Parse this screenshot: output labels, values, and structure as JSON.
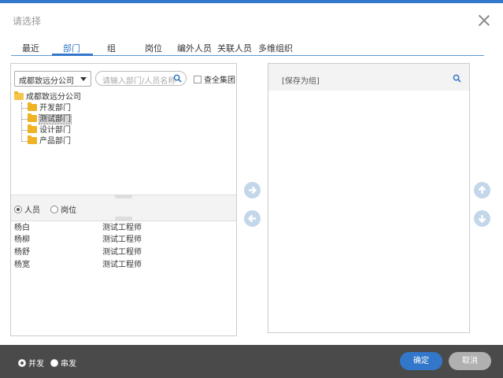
{
  "dialog": {
    "title": "请选择"
  },
  "tabs": [
    {
      "label": "最近"
    },
    {
      "label": "部门"
    },
    {
      "label": "组"
    },
    {
      "label": "岗位"
    },
    {
      "label": "编外人员"
    },
    {
      "label": "关联人员"
    },
    {
      "label": "多维组织"
    }
  ],
  "active_tab": "部门",
  "left": {
    "company_select": "成都致远分公司",
    "search_placeholder": "请输入部门/人员名称",
    "check_all_group": "查全集团",
    "tree": {
      "root": "成都致远分公司",
      "children": [
        "开发部门",
        "测试部门",
        "设计部门",
        "产品部门"
      ],
      "selected": "测试部门"
    },
    "radio_person": "人员",
    "radio_post": "岗位",
    "people": [
      {
        "name": "杨白",
        "role": "测试工程师"
      },
      {
        "name": "杨柳",
        "role": "测试工程师"
      },
      {
        "name": "杨舒",
        "role": "测试工程师"
      },
      {
        "name": "杨宽",
        "role": "测试工程师"
      }
    ]
  },
  "right": {
    "title": "[保存为组]"
  },
  "footer": {
    "radio_parallel": "并发",
    "radio_serial": "串发",
    "ok": "确定",
    "cancel": "取消"
  },
  "colors": {
    "accent": "#3277c9",
    "footer": "#4a4a4a",
    "folder": "#f0b324",
    "arrow_circle": "#c3d6ea"
  }
}
